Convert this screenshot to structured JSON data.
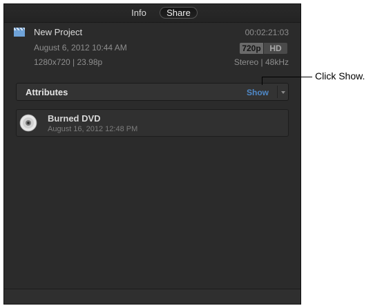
{
  "tabs": [
    {
      "label": "Info"
    },
    {
      "label": "Share"
    }
  ],
  "project": {
    "title": "New Project",
    "date": "August 6, 2012 10:44 AM",
    "format": "1280x720  |  23.98p",
    "duration": "00:02:21:03",
    "resolution_badge": "720p",
    "quality_badge": "HD",
    "audio": "Stereo  |  48kHz"
  },
  "attributes": {
    "label": "Attributes",
    "show_label": "Show"
  },
  "share_item": {
    "title": "Burned DVD",
    "date": "August 16, 2012 12:48 PM"
  },
  "callout": {
    "text": "Click Show."
  },
  "colors": {
    "panel_bg": "#2b2b2b",
    "accent_show": "#4f89c8"
  },
  "icons": {
    "project": "clapperboard-icon",
    "dvd": "dvd-disc-icon",
    "dropdown": "chevron-down-icon"
  }
}
